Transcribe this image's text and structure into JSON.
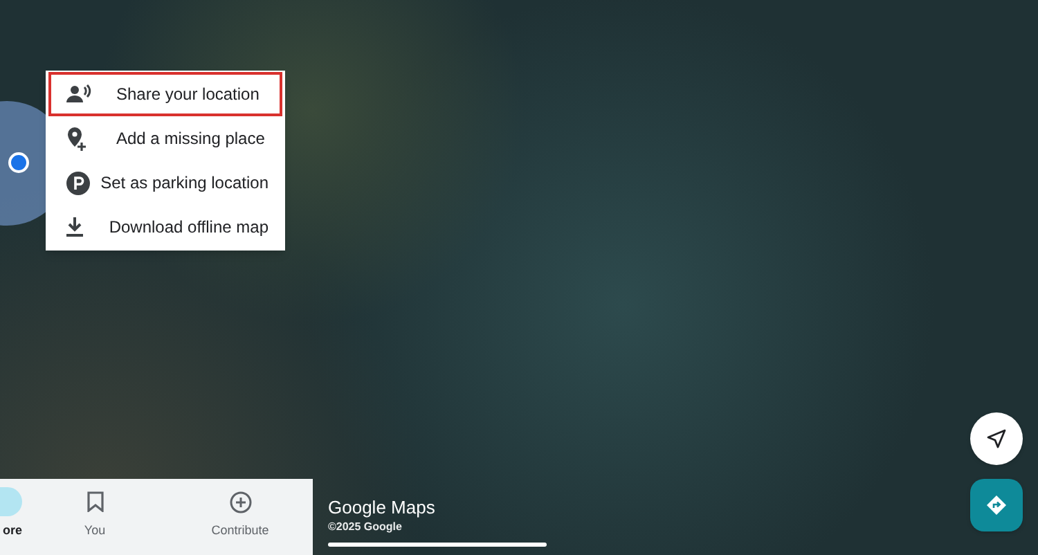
{
  "menu": {
    "items": [
      {
        "kind": "share",
        "label": "Share your location",
        "highlighted": true
      },
      {
        "kind": "add-place",
        "label": "Add a missing place",
        "highlighted": false
      },
      {
        "kind": "parking",
        "label": "Set as parking location",
        "highlighted": false
      },
      {
        "kind": "download",
        "label": "Download offline map",
        "highlighted": false
      }
    ]
  },
  "bottom_nav": [
    {
      "kind": "explore",
      "label": "ore",
      "selected": true
    },
    {
      "kind": "you",
      "label": "You",
      "selected": false
    },
    {
      "kind": "contribute",
      "label": "Contribute",
      "selected": false
    }
  ],
  "map_branding": {
    "logo": "Google Maps",
    "copyright": "©2025 Google"
  }
}
